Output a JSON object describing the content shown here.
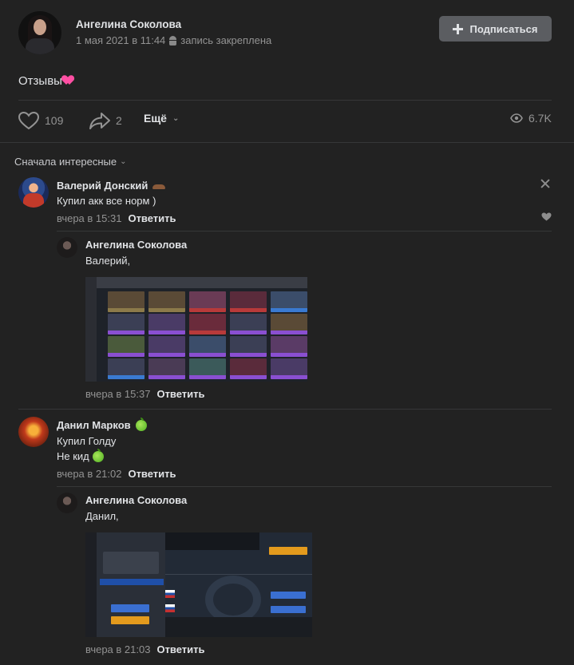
{
  "post": {
    "author": "Ангелина Соколова",
    "date": "1 мая 2021 в 11:44",
    "pinned_label": "запись закреплена",
    "subscribe_label": "Подписаться",
    "text": "Отзывы",
    "likes": "109",
    "shares": "2",
    "more_label": "Ещё",
    "views": "6.7K"
  },
  "sort_label": "Сначала интересные",
  "reply_label": "Ответить",
  "comments": [
    {
      "author": "Валерий Донский",
      "text": "Купил акк все норм )",
      "date": "вчера в 15:31",
      "reply": {
        "author": "Ангелина Соколова",
        "text": "Валерий,",
        "date": "вчера в 15:37"
      }
    },
    {
      "author": "Данил Марков",
      "lines": [
        "Купил Голду",
        "Не кид"
      ],
      "date": "вчера в 21:02",
      "reply": {
        "author": "Ангелина Соколова",
        "text": "Данил,",
        "date": "вчера в 21:03"
      }
    }
  ],
  "colors": {
    "background": "#222222",
    "text": "#e1e3e6",
    "secondary": "#939393",
    "button": "#5b5d61"
  },
  "icons": [
    "android-icon",
    "plus-icon",
    "like-icon",
    "share-icon",
    "views-icon",
    "close-icon",
    "heart-icon",
    "apple-emoji",
    "mustache-emoji"
  ]
}
